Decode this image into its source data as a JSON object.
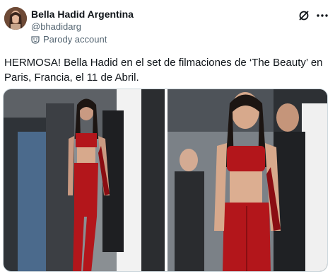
{
  "account": {
    "display_name": "Bella Hadid Argentina",
    "handle": "@bhadidarg",
    "badge_label": "Parody account"
  },
  "tweet": {
    "text": "HERMOSA! Bella Hadid en el set de filmaciones de ‘The Beauty’ en Paris, Francia, el 11 de Abril."
  },
  "icons": {
    "avatar": "avatar-photo",
    "badge": "parody-mask-icon",
    "grok": "grok-icon",
    "more": "more-options-icon"
  },
  "colors": {
    "text_primary": "#0f1419",
    "text_secondary": "#536471",
    "border": "#cfd9de",
    "outfit_red": "#b3161b"
  },
  "media": {
    "count": 2
  }
}
